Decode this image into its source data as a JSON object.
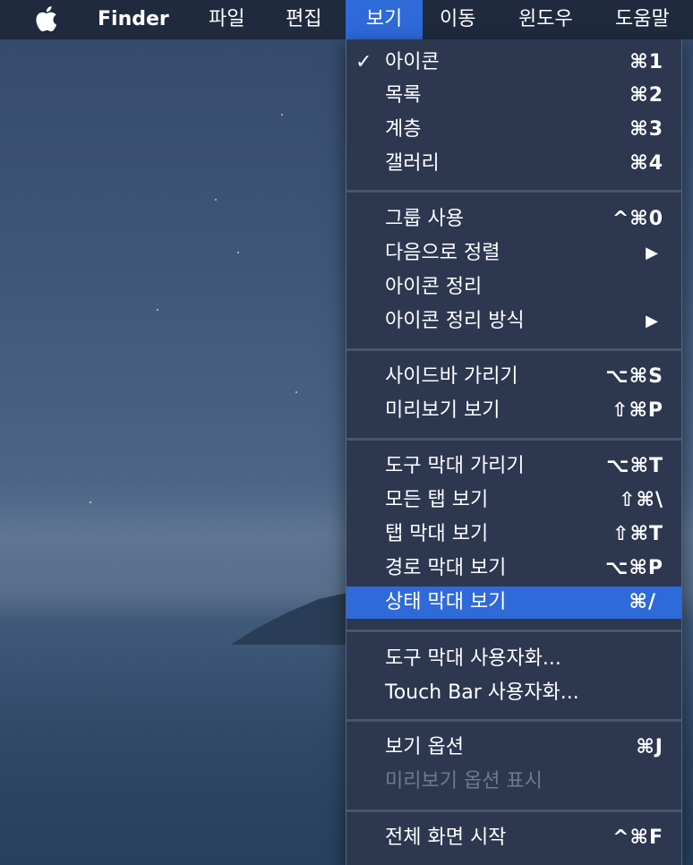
{
  "menubar": {
    "apple_icon": "apple-logo-icon",
    "app_name": "Finder",
    "items": [
      "파일",
      "편집",
      "보기",
      "이동",
      "윈도우",
      "도움말"
    ],
    "active_item": "보기"
  },
  "menu": {
    "items": [
      {
        "label": "아이콘",
        "shortcut": "⌘1",
        "checked": true,
        "check": "✓"
      },
      {
        "label": "목록",
        "shortcut": "⌘2"
      },
      {
        "label": "계층",
        "shortcut": "⌘3"
      },
      {
        "label": "갤러리",
        "shortcut": "⌘4"
      },
      {
        "label": "그룹 사용",
        "shortcut": "^⌘0"
      },
      {
        "label": "다음으로 정렬",
        "submenu": "▶"
      },
      {
        "label": "아이콘 정리"
      },
      {
        "label": "아이콘 정리 방식",
        "submenu": "▶"
      },
      {
        "label": "사이드바 가리기",
        "shortcut": "⌥⌘S"
      },
      {
        "label": "미리보기 보기",
        "shortcut": "⇧⌘P"
      },
      {
        "label": "도구 막대 가리기",
        "shortcut": "⌥⌘T"
      },
      {
        "label": "모든 탭 보기",
        "shortcut": "⇧⌘\\"
      },
      {
        "label": "탭 막대 보기",
        "shortcut": "⇧⌘T"
      },
      {
        "label": "경로 막대 보기",
        "shortcut": "⌥⌘P"
      },
      {
        "label": "상태 막대 보기",
        "shortcut": "⌘/",
        "highlighted": true
      },
      {
        "label": "도구 막대 사용자화..."
      },
      {
        "label": "Touch Bar 사용자화..."
      },
      {
        "label": "보기 옵션",
        "shortcut": "⌘J"
      },
      {
        "label": "미리보기 옵션 표시",
        "disabled": true
      },
      {
        "label": "전체 화면 시작",
        "shortcut": "^⌘F"
      }
    ]
  },
  "colors": {
    "menubar_bg": "#1f2a3e",
    "menu_bg": "#2d3750",
    "highlight": "#2f6ad9",
    "disabled_text": "#6f7890"
  }
}
